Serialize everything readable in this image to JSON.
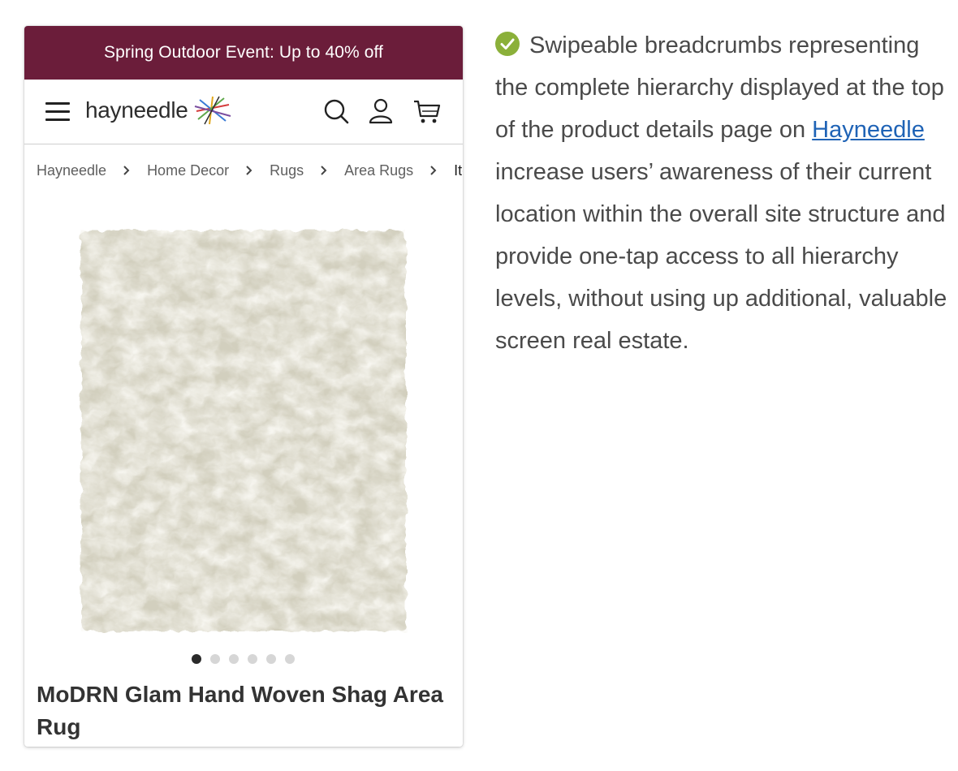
{
  "promo": {
    "text": "Spring Outdoor Event: Up to 40% off",
    "bg_color": "#6b1d3a"
  },
  "header": {
    "logo_text": "hayneedle",
    "icons": [
      "menu-icon",
      "search-icon",
      "account-icon",
      "cart-icon"
    ]
  },
  "breadcrumbs": {
    "items": [
      "Hayneedle",
      "Home Decor",
      "Rugs",
      "Area Rugs",
      "Ite"
    ]
  },
  "product": {
    "image_icon": "rug-image",
    "carousel": {
      "total": 6,
      "active_index": 0
    },
    "title": "MoDRN Glam Hand Woven Shag Area Rug"
  },
  "annotation": {
    "status_icon": "check-circle-icon",
    "status_color": "#8bb03a",
    "text_before_link": "Swipeable breadcrumbs representing the complete hierarchy displayed at the top of the product details page on ",
    "link_text": "Hayneedle",
    "text_after_link": " increase users’ awareness of their current location within the overall site structure and provide one-tap access to all hierarchy levels, without using up additional, valuable screen real estate.",
    "link_color": "#1f63b6"
  }
}
